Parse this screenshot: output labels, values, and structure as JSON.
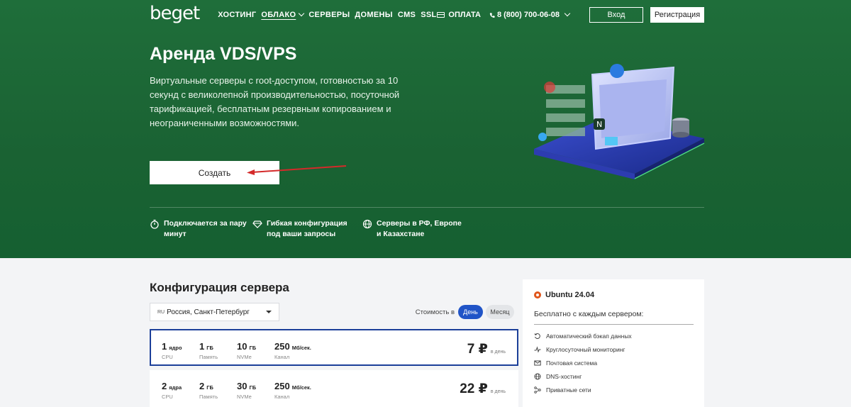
{
  "header": {
    "logo": "beget",
    "nav": [
      {
        "label": "ХОСТИНГ",
        "active": false
      },
      {
        "label": "ОБЛАКО",
        "active": true,
        "dropdown": true
      },
      {
        "label": "СЕРВЕРЫ",
        "active": false
      },
      {
        "label": "ДОМЕНЫ",
        "active": false
      },
      {
        "label": "CMS",
        "active": false
      },
      {
        "label": "SSL",
        "active": false
      }
    ],
    "pay_label": "ОПЛАТА",
    "phone": "8 (800) 700-06-08",
    "login_label": "Вход",
    "register_label": "Регистрация"
  },
  "hero": {
    "title": "Аренда VDS/VPS",
    "description": "Виртуальные серверы с root-доступом, готовностью за 10 секунд с великолепной производительностью, посуточной тарификацией, бесплатным резервным копированием и неограниченными возможностями.",
    "create_label": "Создать",
    "features": [
      {
        "icon": "stopwatch-icon",
        "text": "Подключается за пару минут"
      },
      {
        "icon": "gem-icon",
        "text": "Гибкая конфигурация под ваши запросы"
      },
      {
        "icon": "globe-icon",
        "text": "Серверы в РФ, Европе и Казахстане"
      }
    ]
  },
  "config": {
    "title": "Конфигурация сервера",
    "region": {
      "flag": "RU",
      "value": "Россия, Санкт-Петербург"
    },
    "price_label": "Стоимость в",
    "period_options": [
      "День",
      "Месяц"
    ],
    "selected_period": "День",
    "plans": [
      {
        "cpu": "1",
        "cpu_unit": "ядро",
        "cpu_label": "CPU",
        "ram": "1",
        "ram_unit": "ГБ",
        "ram_label": "Память",
        "disk": "10",
        "disk_unit": "ГБ",
        "disk_label": "NVMe",
        "channel": "250",
        "channel_unit": "Мб/сек.",
        "channel_label": "Канал",
        "price": "7 ₽",
        "per": "в день",
        "selected": true
      },
      {
        "cpu": "2",
        "cpu_unit": "ядра",
        "cpu_label": "CPU",
        "ram": "2",
        "ram_unit": "ГБ",
        "ram_label": "Память",
        "disk": "30",
        "disk_unit": "ГБ",
        "disk_label": "NVMe",
        "channel": "250",
        "channel_unit": "Мб/сек.",
        "channel_label": "Канал",
        "price": "22 ₽",
        "per": "в день",
        "selected": false
      }
    ]
  },
  "side": {
    "os": "Ubuntu 24.04",
    "free_label": "Бесплатно с каждым сервером:",
    "perks": [
      {
        "icon": "backup-icon",
        "text": "Автоматический бэкап данных"
      },
      {
        "icon": "monitoring-icon",
        "text": "Круглосуточный мониторинг"
      },
      {
        "icon": "mail-icon",
        "text": "Почтовая система"
      },
      {
        "icon": "globe-icon",
        "text": "DNS-хостинг"
      },
      {
        "icon": "network-icon",
        "text": "Приватные сети"
      }
    ]
  },
  "colors": {
    "hero_green": "#1a6233",
    "accent_blue": "#2054c7",
    "selected_border": "#1c3f99"
  }
}
